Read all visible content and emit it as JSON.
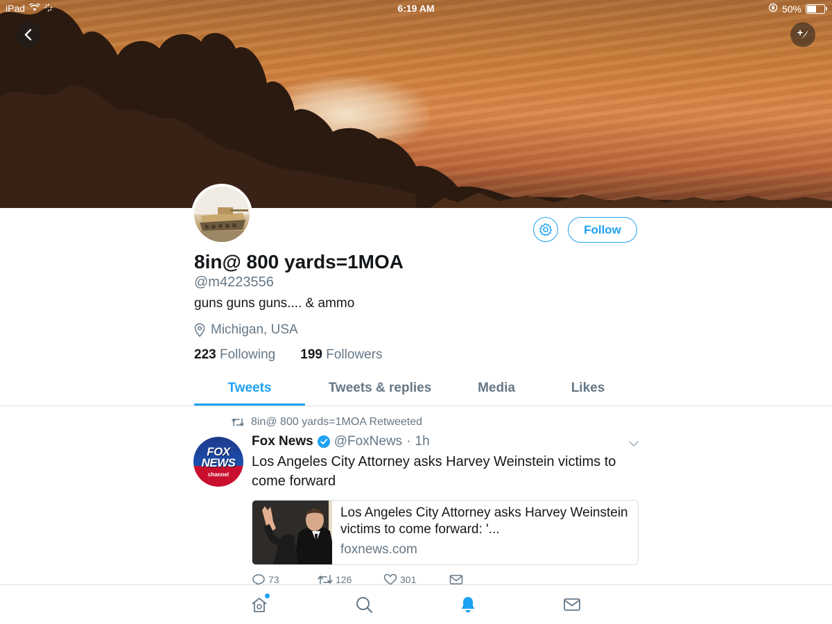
{
  "status_bar": {
    "device": "iPad",
    "time": "6:19 AM",
    "battery": "50%",
    "battery_level": 0.5
  },
  "header": {
    "back_icon": "chevron-left-icon",
    "compose_icon": "compose-tweet-icon"
  },
  "profile": {
    "display_name": "8in@ 800 yards=1MOA",
    "handle": "@m4223556",
    "bio": "guns guns guns.... & ammo",
    "location": "Michigan, USA",
    "following_count": "223",
    "following_label": "Following",
    "followers_count": "199",
    "followers_label": "Followers",
    "follow_label": "Follow",
    "settings_icon": "gear-icon"
  },
  "tabs": [
    {
      "label": "Tweets",
      "active": true
    },
    {
      "label": "Tweets & replies",
      "active": false
    },
    {
      "label": "Media",
      "active": false
    },
    {
      "label": "Likes",
      "active": false
    }
  ],
  "tweet": {
    "retweet_note": "8in@ 800 yards=1MOA Retweeted",
    "author_name": "Fox News",
    "author_handle": "@FoxNews",
    "separator": "·",
    "time": "1h",
    "avatar_word_1": "FOX",
    "avatar_word_2": "NEWS",
    "avatar_word_3": "channel",
    "text": "Los Angeles City Attorney asks Harvey Weinstein victims to come forward",
    "card": {
      "title": "Los Angeles City Attorney asks Harvey Weinstein victims to come forward: '...",
      "domain": "foxnews.com"
    },
    "actions": {
      "replies": "73",
      "retweets": "126",
      "likes": "301"
    }
  },
  "bottom_nav": {
    "items": [
      "home-icon",
      "search-icon",
      "notifications-icon",
      "messages-icon"
    ],
    "active": "notifications-icon"
  },
  "colors": {
    "accent": "#1da1f2",
    "secondary_text": "#657786",
    "primary_text": "#14171a"
  }
}
